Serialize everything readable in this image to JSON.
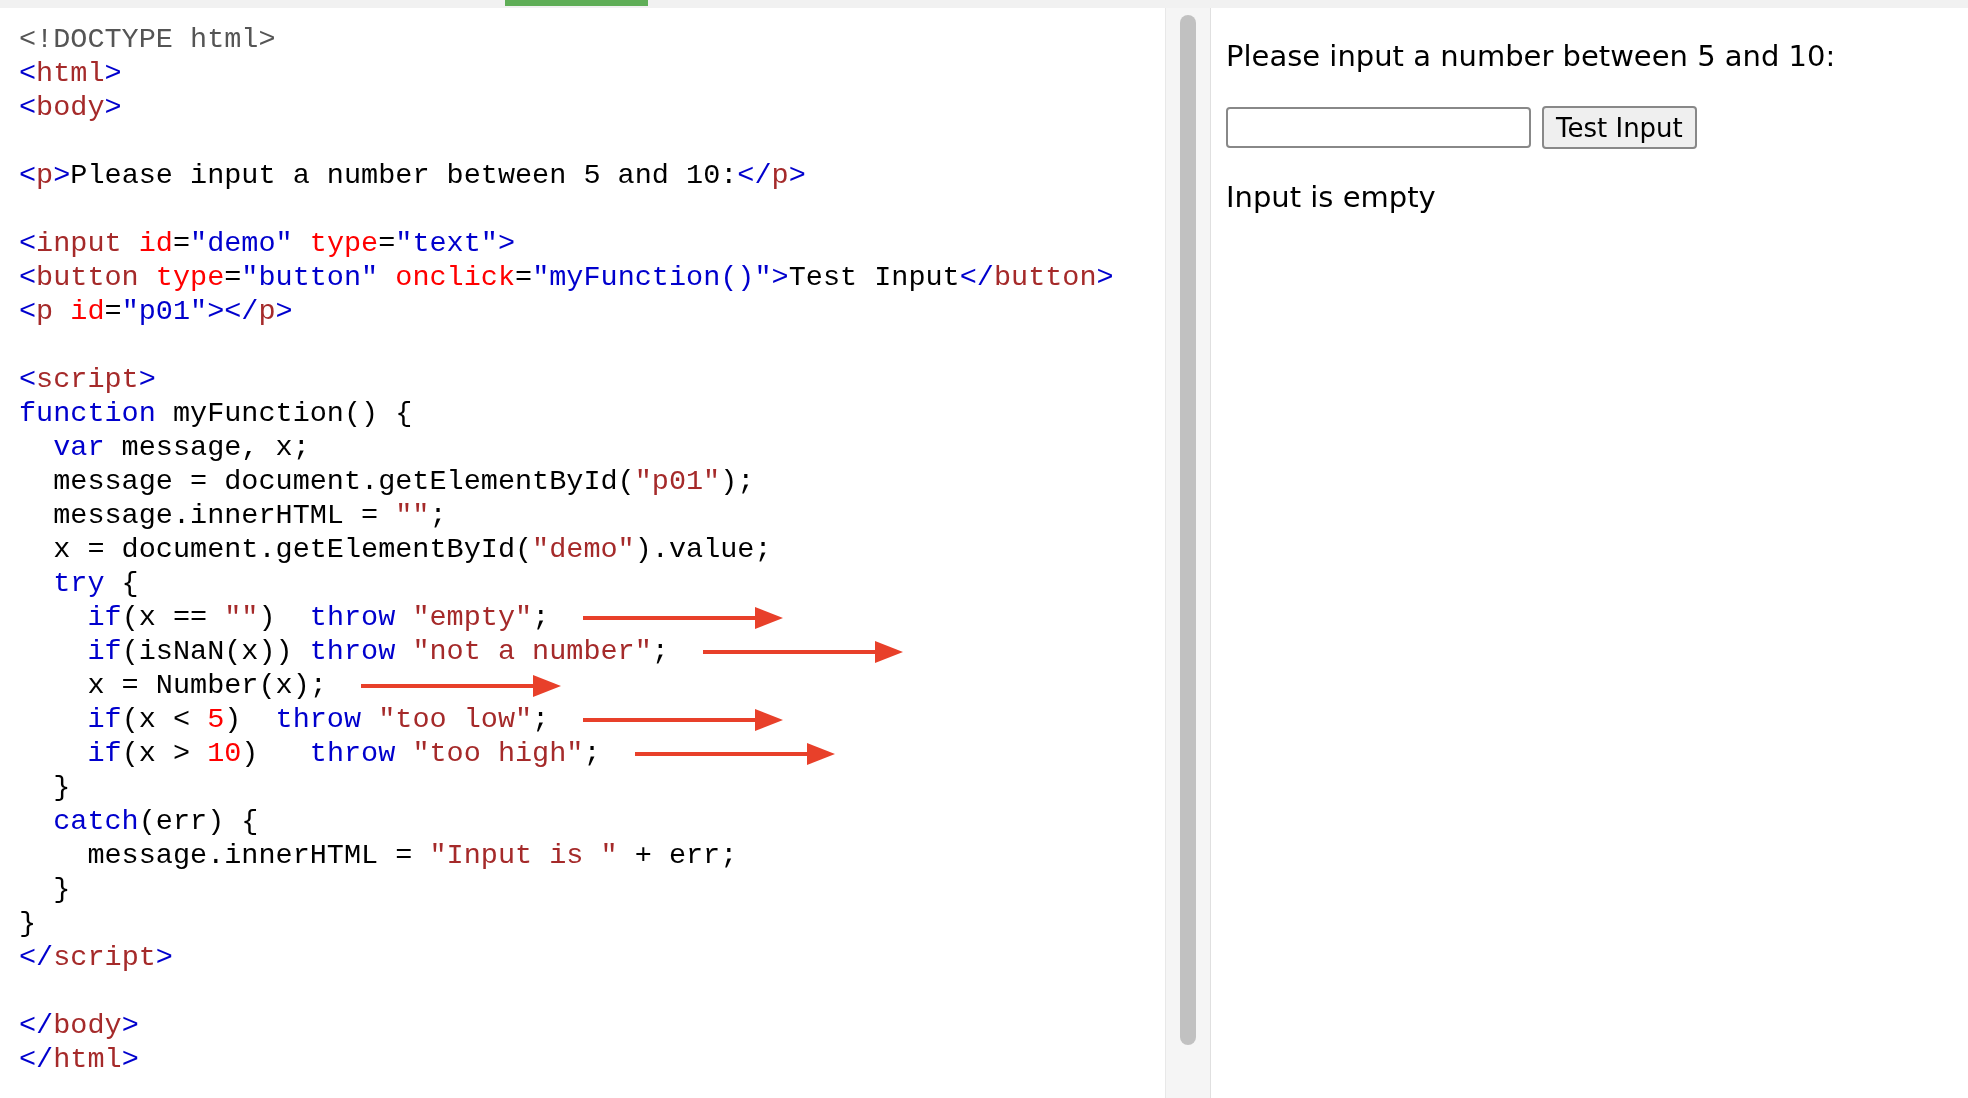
{
  "editor": {
    "lines": [
      {
        "kind": "code",
        "tokens": [
          {
            "kind": "doc",
            "text": "<!DOCTYPE html>"
          }
        ]
      },
      {
        "kind": "code",
        "tokens": [
          {
            "kind": "br",
            "text": "<"
          },
          {
            "kind": "tag",
            "text": "html"
          },
          {
            "kind": "br",
            "text": ">"
          }
        ]
      },
      {
        "kind": "code",
        "tokens": [
          {
            "kind": "br",
            "text": "<"
          },
          {
            "kind": "tag",
            "text": "body"
          },
          {
            "kind": "br",
            "text": ">"
          }
        ]
      },
      {
        "kind": "blank"
      },
      {
        "kind": "code",
        "tokens": [
          {
            "kind": "br",
            "text": "<"
          },
          {
            "kind": "tag",
            "text": "p"
          },
          {
            "kind": "br",
            "text": ">"
          },
          {
            "kind": "txt",
            "text": "Please input a number between 5 and 10:"
          },
          {
            "kind": "br",
            "text": "</"
          },
          {
            "kind": "tag",
            "text": "p"
          },
          {
            "kind": "br",
            "text": ">"
          }
        ]
      },
      {
        "kind": "blank"
      },
      {
        "kind": "code",
        "tokens": [
          {
            "kind": "br",
            "text": "<"
          },
          {
            "kind": "tag",
            "text": "input"
          },
          {
            "kind": "attr",
            "text": " id"
          },
          {
            "kind": "txt",
            "text": "="
          },
          {
            "kind": "val",
            "text": "\"demo\""
          },
          {
            "kind": "attr",
            "text": " type"
          },
          {
            "kind": "txt",
            "text": "="
          },
          {
            "kind": "val",
            "text": "\"text\""
          },
          {
            "kind": "br",
            "text": ">"
          }
        ]
      },
      {
        "kind": "code",
        "tokens": [
          {
            "kind": "br",
            "text": "<"
          },
          {
            "kind": "tag",
            "text": "button"
          },
          {
            "kind": "attr",
            "text": " type"
          },
          {
            "kind": "txt",
            "text": "="
          },
          {
            "kind": "val",
            "text": "\"button\""
          },
          {
            "kind": "attr",
            "text": " onclick"
          },
          {
            "kind": "txt",
            "text": "="
          },
          {
            "kind": "val",
            "text": "\"myFunction()\""
          },
          {
            "kind": "br",
            "text": ">"
          },
          {
            "kind": "txt",
            "text": "Test Input"
          },
          {
            "kind": "br",
            "text": "</"
          },
          {
            "kind": "tag",
            "text": "button"
          },
          {
            "kind": "br",
            "text": ">"
          }
        ]
      },
      {
        "kind": "code",
        "tokens": [
          {
            "kind": "br",
            "text": "<"
          },
          {
            "kind": "tag",
            "text": "p"
          },
          {
            "kind": "attr",
            "text": " id"
          },
          {
            "kind": "txt",
            "text": "="
          },
          {
            "kind": "val",
            "text": "\"p01\""
          },
          {
            "kind": "br",
            "text": "></"
          },
          {
            "kind": "tag",
            "text": "p"
          },
          {
            "kind": "br",
            "text": ">"
          }
        ]
      },
      {
        "kind": "blank"
      },
      {
        "kind": "code",
        "tokens": [
          {
            "kind": "br",
            "text": "<"
          },
          {
            "kind": "tag",
            "text": "script"
          },
          {
            "kind": "br",
            "text": ">"
          }
        ]
      },
      {
        "kind": "code",
        "tokens": [
          {
            "kind": "kw",
            "text": "function"
          },
          {
            "kind": "txt",
            "text": " myFunction() {"
          }
        ]
      },
      {
        "kind": "code",
        "tokens": [
          {
            "kind": "kw",
            "text": "  var"
          },
          {
            "kind": "txt",
            "text": " message, x;"
          }
        ]
      },
      {
        "kind": "code",
        "tokens": [
          {
            "kind": "txt",
            "text": "  message = document.getElementById("
          },
          {
            "kind": "str",
            "text": "\"p01\""
          },
          {
            "kind": "txt",
            "text": ");"
          }
        ]
      },
      {
        "kind": "code",
        "tokens": [
          {
            "kind": "txt",
            "text": "  message.innerHTML = "
          },
          {
            "kind": "str",
            "text": "\"\""
          },
          {
            "kind": "txt",
            "text": ";"
          }
        ]
      },
      {
        "kind": "code",
        "tokens": [
          {
            "kind": "txt",
            "text": "  x = document.getElementById("
          },
          {
            "kind": "str",
            "text": "\"demo\""
          },
          {
            "kind": "txt",
            "text": ").value;"
          }
        ]
      },
      {
        "kind": "code",
        "tokens": [
          {
            "kind": "kw",
            "text": "  try"
          },
          {
            "kind": "txt",
            "text": " {"
          }
        ]
      },
      {
        "kind": "code",
        "arrow": true,
        "tokens": [
          {
            "kind": "kw",
            "text": "    if"
          },
          {
            "kind": "txt",
            "text": "(x == "
          },
          {
            "kind": "str",
            "text": "\"\""
          },
          {
            "kind": "txt",
            "text": ")  "
          },
          {
            "kind": "kw",
            "text": "throw"
          },
          {
            "kind": "str",
            "text": " \"empty\""
          },
          {
            "kind": "txt",
            "text": ";"
          }
        ]
      },
      {
        "kind": "code",
        "arrow": true,
        "tokens": [
          {
            "kind": "kw",
            "text": "    if"
          },
          {
            "kind": "txt",
            "text": "(isNaN(x)) "
          },
          {
            "kind": "kw",
            "text": "throw"
          },
          {
            "kind": "str",
            "text": " \"not a number\""
          },
          {
            "kind": "txt",
            "text": ";"
          }
        ]
      },
      {
        "kind": "code",
        "arrow": true,
        "tokens": [
          {
            "kind": "txt",
            "text": "    x = Number(x);"
          }
        ]
      },
      {
        "kind": "code",
        "arrow": true,
        "tokens": [
          {
            "kind": "kw",
            "text": "    if"
          },
          {
            "kind": "txt",
            "text": "(x < "
          },
          {
            "kind": "num",
            "text": "5"
          },
          {
            "kind": "txt",
            "text": ")  "
          },
          {
            "kind": "kw",
            "text": "throw"
          },
          {
            "kind": "str",
            "text": " \"too low\""
          },
          {
            "kind": "txt",
            "text": ";"
          }
        ]
      },
      {
        "kind": "code",
        "arrow": true,
        "tokens": [
          {
            "kind": "kw",
            "text": "    if"
          },
          {
            "kind": "txt",
            "text": "(x > "
          },
          {
            "kind": "num",
            "text": "10"
          },
          {
            "kind": "txt",
            "text": ")   "
          },
          {
            "kind": "kw",
            "text": "throw"
          },
          {
            "kind": "str",
            "text": " \"too high\""
          },
          {
            "kind": "txt",
            "text": ";"
          }
        ]
      },
      {
        "kind": "code",
        "tokens": [
          {
            "kind": "txt",
            "text": "  }"
          }
        ]
      },
      {
        "kind": "code",
        "tokens": [
          {
            "kind": "kw",
            "text": "  catch"
          },
          {
            "kind": "txt",
            "text": "(err) {"
          }
        ]
      },
      {
        "kind": "code",
        "tokens": [
          {
            "kind": "txt",
            "text": "    message.innerHTML = "
          },
          {
            "kind": "str",
            "text": "\"Input is \""
          },
          {
            "kind": "txt",
            "text": " + err;"
          }
        ]
      },
      {
        "kind": "code",
        "tokens": [
          {
            "kind": "txt",
            "text": "  }"
          }
        ]
      },
      {
        "kind": "code",
        "tokens": [
          {
            "kind": "txt",
            "text": "}"
          }
        ]
      },
      {
        "kind": "code",
        "tokens": [
          {
            "kind": "br",
            "text": "</"
          },
          {
            "kind": "tag",
            "text": "script"
          },
          {
            "kind": "br",
            "text": ">"
          }
        ]
      },
      {
        "kind": "blank"
      },
      {
        "kind": "code",
        "tokens": [
          {
            "kind": "br",
            "text": "</"
          },
          {
            "kind": "tag",
            "text": "body"
          },
          {
            "kind": "br",
            "text": ">"
          }
        ]
      },
      {
        "kind": "code",
        "tokens": [
          {
            "kind": "br",
            "text": "</"
          },
          {
            "kind": "tag",
            "text": "html"
          },
          {
            "kind": "br",
            "text": ">"
          }
        ]
      }
    ]
  },
  "preview": {
    "prompt": "Please input a number between 5 and 10:",
    "button": "Test Input",
    "result": "Input is empty"
  }
}
